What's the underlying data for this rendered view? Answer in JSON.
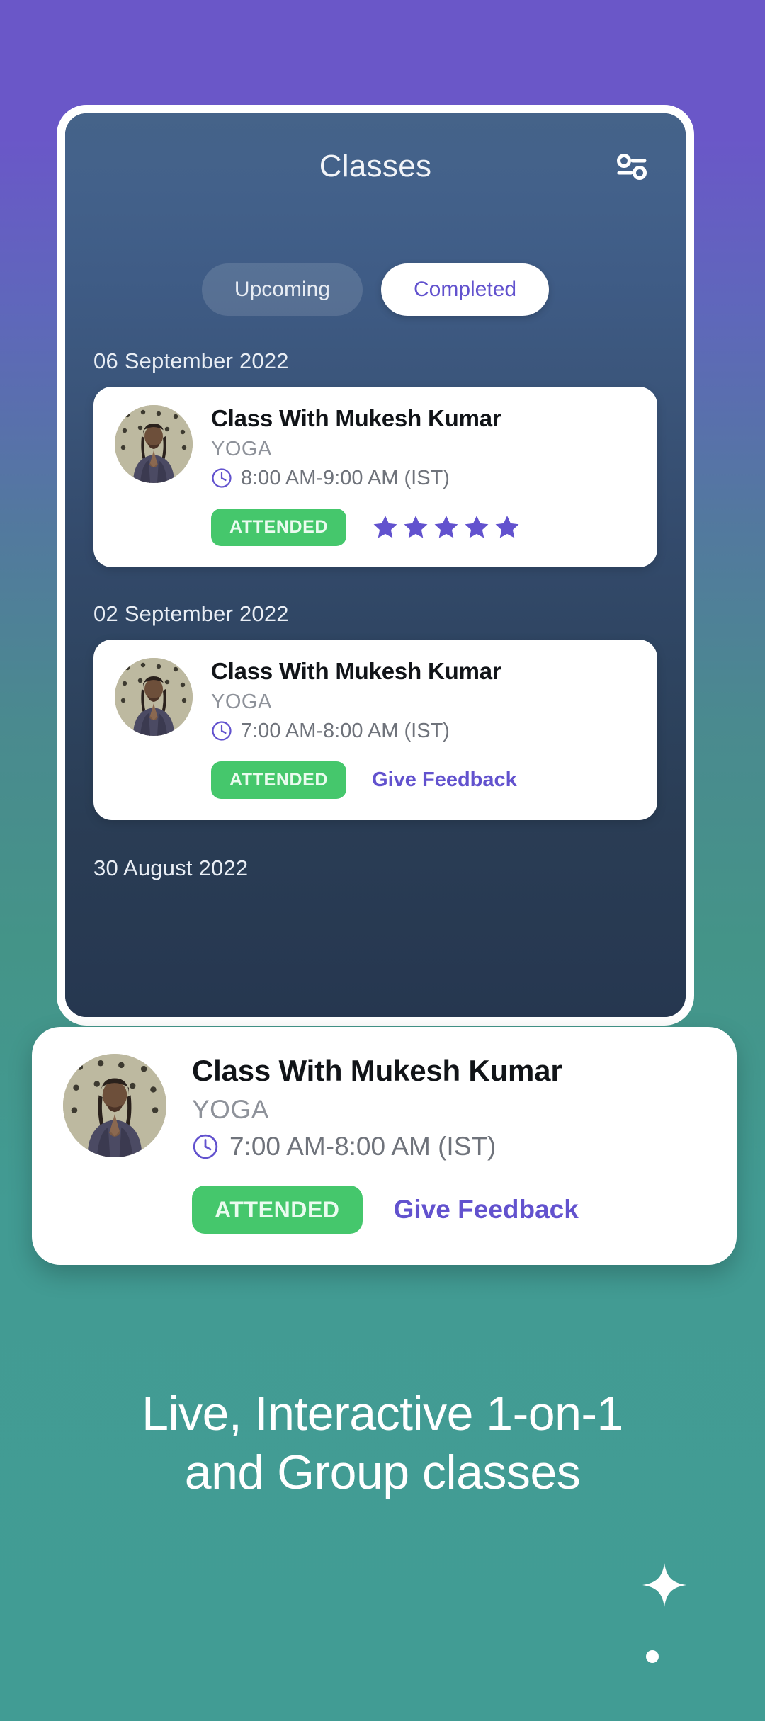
{
  "background": {
    "top_color": "#6a57c8",
    "bottom_color": "#419c94"
  },
  "phone": {
    "screen_bg": "#2b3c55",
    "header": {
      "title": "Classes",
      "filter_icon": "filter-settings-icon"
    },
    "tabs": [
      {
        "label": "Upcoming",
        "active": false
      },
      {
        "label": "Completed",
        "active": true
      }
    ],
    "groups": [
      {
        "date": "06 September 2022",
        "card": {
          "title": "Class With Mukesh Kumar",
          "type": "YOGA",
          "time_icon": "clock-icon",
          "time": "8:00 AM-9:00 AM (IST)",
          "status": "ATTENDED",
          "rating": 5,
          "feedback_label": null
        }
      },
      {
        "date": "02 September 2022",
        "card": {
          "title": "Class With Mukesh Kumar",
          "type": "YOGA",
          "time_icon": "clock-icon",
          "time": "7:00 AM-8:00 AM (IST)",
          "status": "ATTENDED",
          "rating": null,
          "feedback_label": "Give Feedback"
        }
      },
      {
        "date": "30 August 2022",
        "card": null
      }
    ]
  },
  "featured_card": {
    "title": "Class With Mukesh Kumar",
    "type": "YOGA",
    "time_icon": "clock-icon",
    "time": "7:00 AM-8:00 AM (IST)",
    "status": "ATTENDED",
    "feedback_label": "Give Feedback"
  },
  "tagline": {
    "line1": "Live, Interactive 1-on-1",
    "line2": "and Group classes"
  },
  "decorations": {
    "sparkle": "sparkle-icon",
    "dot": "dot-icon"
  },
  "colors": {
    "accent_purple": "#6252ce",
    "status_green": "#45c76c",
    "star_purple": "#6252ce",
    "card_white": "#ffffff",
    "phone_navy": "#2b3c55"
  }
}
